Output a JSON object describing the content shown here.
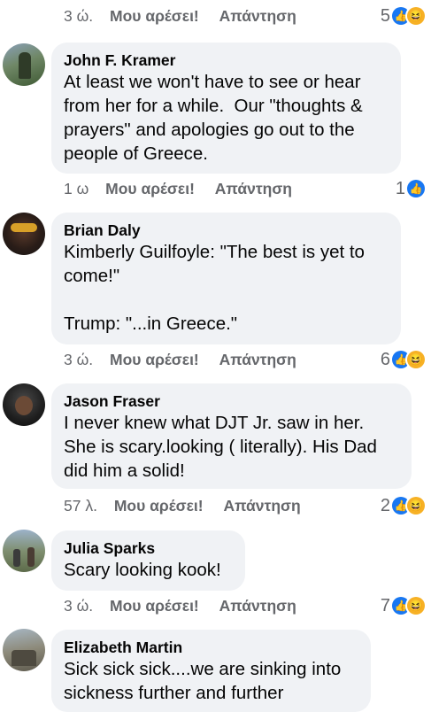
{
  "colors": {
    "bubble": "#f0f2f5",
    "meta": "#65676b",
    "like": "#1877f2",
    "haha": "#f7b125"
  },
  "comments": [
    {
      "id": "top",
      "time": "3 ώ.",
      "like": "Μου αρέσει!",
      "reply": "Απάντηση",
      "reactions": "5",
      "reaction_icons": [
        "like-icon",
        "haha-icon"
      ]
    },
    {
      "id": "kramer",
      "name": "John F. Kramer",
      "text": "At least we won't have to see or hear\nfrom her for a while.  Our \"thoughts &\nprayers\" and apologies go out to the\npeople of Greece.",
      "time": "1 ω",
      "like": "Μου αρέσει!",
      "reply": "Απάντηση",
      "reactions": "1",
      "reaction_icons": [
        "like-icon"
      ]
    },
    {
      "id": "daly",
      "name": "Brian Daly",
      "text": "Kimberly Guilfoyle: \"The best is yet to\ncome!\"\n\nTrump: \"...in Greece.\"",
      "time": "3 ώ.",
      "like": "Μου αρέσει!",
      "reply": "Απάντηση",
      "reactions": "6",
      "reaction_icons": [
        "like-icon",
        "haha-icon"
      ]
    },
    {
      "id": "fraser",
      "name": "Jason Fraser",
      "text": "I never knew what DJT Jr. saw in her.\nShe is scary.looking ( literally). His Dad\ndid him a solid!",
      "time": "57 λ.",
      "like": "Μου αρέσει!",
      "reply": "Απάντηση",
      "reactions": "2",
      "reaction_icons": [
        "like-icon",
        "haha-icon"
      ]
    },
    {
      "id": "sparks",
      "name": "Julia Sparks",
      "text": "Scary looking kook!",
      "time": "3 ώ.",
      "like": "Μου αρέσει!",
      "reply": "Απάντηση",
      "reactions": "7",
      "reaction_icons": [
        "like-icon",
        "haha-icon"
      ]
    },
    {
      "id": "martin",
      "name": "Elizabeth Martin",
      "text": "Sick sick sick....we are sinking into\nsickness further and further"
    }
  ]
}
